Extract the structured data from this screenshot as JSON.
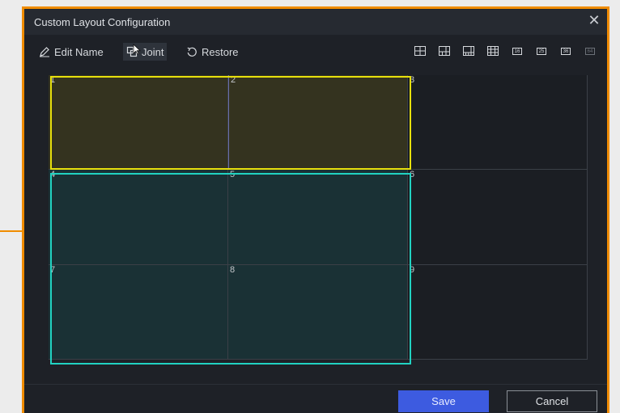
{
  "window": {
    "title": "Custom Layout Configuration",
    "close_glyph": "✕"
  },
  "toolbar": {
    "edit_name": "Edit Name",
    "joint": "Joint",
    "restore": "Restore",
    "layout_icons": [
      {
        "name": "layout-1-3-icon",
        "label": ""
      },
      {
        "name": "layout-1-5-icon",
        "label": ""
      },
      {
        "name": "layout-1-7-icon",
        "label": ""
      },
      {
        "name": "layout-12-icon",
        "label": ""
      },
      {
        "name": "layout-16-icon",
        "label": "16"
      },
      {
        "name": "layout-25-icon",
        "label": "25"
      },
      {
        "name": "layout-36-icon",
        "label": "36"
      },
      {
        "name": "layout-64-icon",
        "label": "64"
      }
    ]
  },
  "grid": {
    "cells": [
      "1",
      "2",
      "3",
      "4",
      "5",
      "6",
      "7",
      "8",
      "9"
    ],
    "tint_colors": {
      "yellow_fill": "#34331f",
      "cyan_fill": "#1a3135",
      "empty_fill": "#1b1e23"
    }
  },
  "colors": {
    "accent_orange": "#f08c00",
    "selection_yellow": "#e7e00c",
    "selection_cyan": "#21d3c2",
    "save_blue": "#3d5be0"
  },
  "footer": {
    "save": "Save",
    "cancel": "Cancel"
  }
}
